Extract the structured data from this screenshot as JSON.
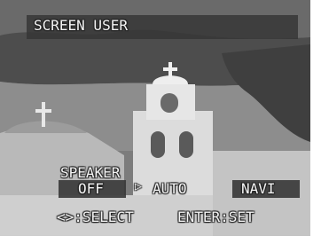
{
  "title": "SCREEN USER",
  "menu": {
    "label": "SPEAKER",
    "options": [
      "OFF",
      "AUTO",
      "NAVI"
    ],
    "selected": "AUTO",
    "pointer_icon": "triangle-right-icon"
  },
  "help": {
    "select": "<>:SELECT",
    "set": "ENTER:SET"
  }
}
